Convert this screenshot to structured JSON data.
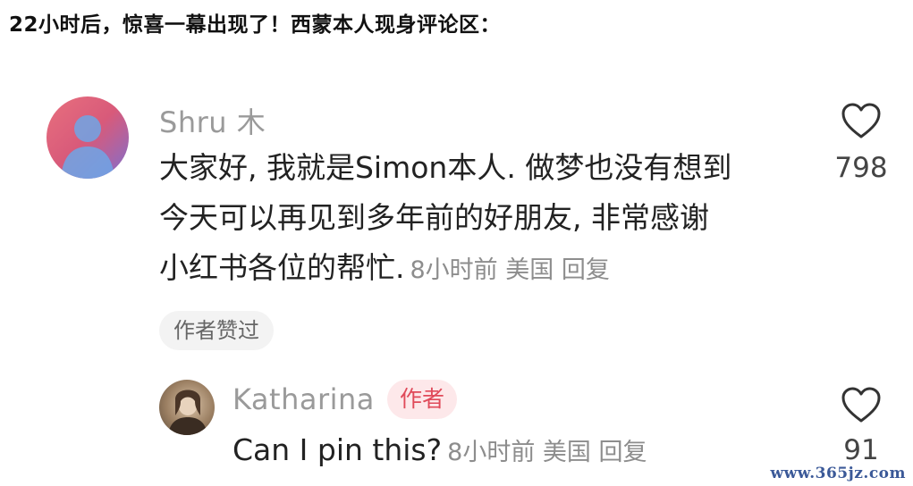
{
  "headline": "22小时后，惊喜一幕出现了！西蒙本人现身评论区：",
  "comment": {
    "username": "Shru 木",
    "lines": [
      "大家好, 我就是Simon本人. 做梦也没有想到",
      "今天可以再见到多年前的好朋友, 非常感谢",
      "小红书各位的帮忙."
    ],
    "meta": "8小时前 美国 回复",
    "chip": "作者赞过",
    "likes": "798"
  },
  "reply": {
    "username": "Katharina",
    "badge": "作者",
    "text": "Can I pin this?",
    "meta": "8小时前 美国 回复",
    "likes": "91"
  },
  "watermark": "www.365jz.com",
  "icons": {
    "avatar_main": "person-silhouette-avatar",
    "avatar_reply": "user-photo-avatar",
    "like": "heart-outline-icon"
  },
  "colors": {
    "muted_text": "#9a9a9a",
    "badge_bg": "#fde8ea",
    "badge_text": "#e04a5a"
  }
}
